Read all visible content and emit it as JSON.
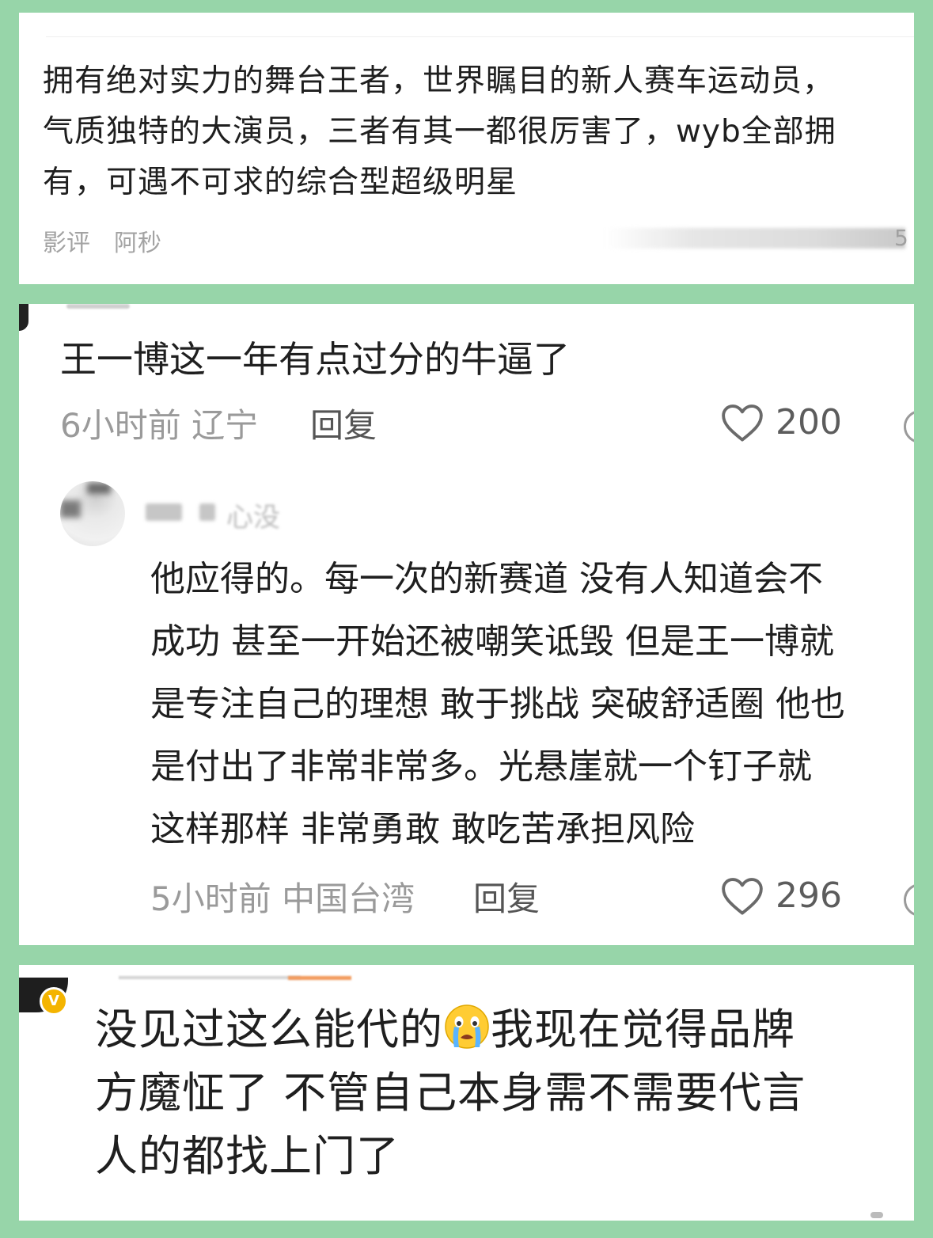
{
  "comment1": {
    "lines": [
      "拥有绝对实力的舞台王者，世界瞩目的新人赛车运动员，",
      "气质独特的大演员，三者有其一都很厉害了，wyb全部拥",
      "有，可遇不可求的综合型超级明星"
    ],
    "tag": "影评",
    "author": "阿秒",
    "count_fragment": "5"
  },
  "comment2": {
    "text": "王一博这一年有点过分的牛逼了",
    "time_location": "6小时前 辽宁",
    "reply_label": "回复",
    "likes": "200",
    "reply": {
      "username_visible": "心没",
      "lines": [
        "他应得的。每一次的新赛道 没有人知道会不",
        "成功 甚至一开始还被嘲笑诋毁 但是王一博就",
        "是专注自己的理想 敢于挑战 突破舒适圈 他也",
        "是付出了非常非常多。光悬崖就一个钉子就",
        "这样那样 非常勇敢 敢吃苦承担风险"
      ],
      "time_location": "5小时前 中国台湾",
      "reply_label": "回复",
      "likes": "296"
    }
  },
  "comment3": {
    "line1_before_emoji": "没见过这么能代的",
    "emoji": "crying-face",
    "line1_after_emoji": "我现在觉得品牌",
    "line2": "方魔怔了 不管自己本身需不需要代言",
    "line3": "人的都找上门了",
    "badge": "V"
  },
  "colors": {
    "background": "#97d5a9",
    "panel": "#ffffff",
    "text": "#1f1f1f",
    "meta": "#9a9a9a",
    "badge": "#f4b400"
  }
}
